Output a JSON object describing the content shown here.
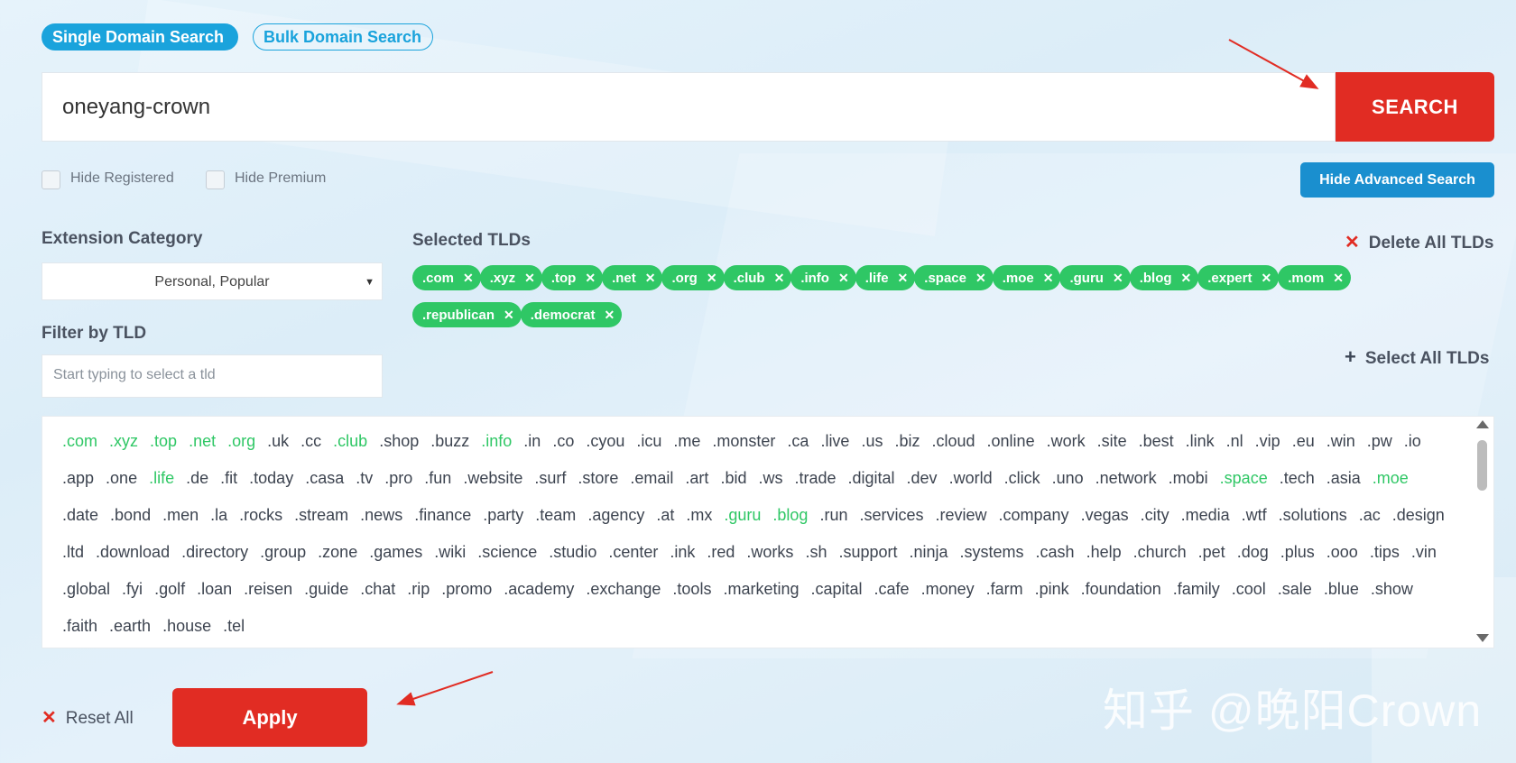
{
  "tabs": {
    "single": "Single Domain Search",
    "bulk": "Bulk Domain Search"
  },
  "search": {
    "value": "oneyang-crown",
    "button": "SEARCH"
  },
  "options": {
    "hide_registered": "Hide Registered",
    "hide_premium": "Hide Premium",
    "advanced_button": "Hide Advanced Search"
  },
  "extension_category": {
    "label": "Extension Category",
    "selected": "Personal, Popular"
  },
  "filter": {
    "label": "Filter by TLD",
    "placeholder": "Start typing to select a tld"
  },
  "selected_tlds": {
    "label": "Selected TLDs",
    "delete_all": "Delete All TLDs",
    "select_all": "Select All TLDs",
    "chips": [
      ".com",
      ".xyz",
      ".top",
      ".net",
      ".org",
      ".club",
      ".info",
      ".life",
      ".space",
      ".moe",
      ".guru",
      ".blog",
      ".expert",
      ".mom",
      ".republican",
      ".democrat"
    ]
  },
  "tld_list": [
    {
      "name": ".com",
      "selected": true
    },
    {
      "name": ".xyz",
      "selected": true
    },
    {
      "name": ".top",
      "selected": true
    },
    {
      "name": ".net",
      "selected": true
    },
    {
      "name": ".org",
      "selected": true
    },
    {
      "name": ".uk",
      "selected": false
    },
    {
      "name": ".cc",
      "selected": false
    },
    {
      "name": ".club",
      "selected": true
    },
    {
      "name": ".shop",
      "selected": false
    },
    {
      "name": ".buzz",
      "selected": false
    },
    {
      "name": ".info",
      "selected": true
    },
    {
      "name": ".in",
      "selected": false
    },
    {
      "name": ".co",
      "selected": false
    },
    {
      "name": ".cyou",
      "selected": false
    },
    {
      "name": ".icu",
      "selected": false
    },
    {
      "name": ".me",
      "selected": false
    },
    {
      "name": ".monster",
      "selected": false
    },
    {
      "name": ".ca",
      "selected": false
    },
    {
      "name": ".live",
      "selected": false
    },
    {
      "name": ".us",
      "selected": false
    },
    {
      "name": ".biz",
      "selected": false
    },
    {
      "name": ".cloud",
      "selected": false
    },
    {
      "name": ".online",
      "selected": false
    },
    {
      "name": ".work",
      "selected": false
    },
    {
      "name": ".site",
      "selected": false
    },
    {
      "name": ".best",
      "selected": false
    },
    {
      "name": ".link",
      "selected": false
    },
    {
      "name": ".nl",
      "selected": false
    },
    {
      "name": ".vip",
      "selected": false
    },
    {
      "name": ".eu",
      "selected": false
    },
    {
      "name": ".win",
      "selected": false
    },
    {
      "name": ".pw",
      "selected": false
    },
    {
      "name": ".io",
      "selected": false
    },
    {
      "name": ".app",
      "selected": false
    },
    {
      "name": ".one",
      "selected": false
    },
    {
      "name": ".life",
      "selected": true
    },
    {
      "name": ".de",
      "selected": false
    },
    {
      "name": ".fit",
      "selected": false
    },
    {
      "name": ".today",
      "selected": false
    },
    {
      "name": ".casa",
      "selected": false
    },
    {
      "name": ".tv",
      "selected": false
    },
    {
      "name": ".pro",
      "selected": false
    },
    {
      "name": ".fun",
      "selected": false
    },
    {
      "name": ".website",
      "selected": false
    },
    {
      "name": ".surf",
      "selected": false
    },
    {
      "name": ".store",
      "selected": false
    },
    {
      "name": ".email",
      "selected": false
    },
    {
      "name": ".art",
      "selected": false
    },
    {
      "name": ".bid",
      "selected": false
    },
    {
      "name": ".ws",
      "selected": false
    },
    {
      "name": ".trade",
      "selected": false
    },
    {
      "name": ".digital",
      "selected": false
    },
    {
      "name": ".dev",
      "selected": false
    },
    {
      "name": ".world",
      "selected": false
    },
    {
      "name": ".click",
      "selected": false
    },
    {
      "name": ".uno",
      "selected": false
    },
    {
      "name": ".network",
      "selected": false
    },
    {
      "name": ".mobi",
      "selected": false
    },
    {
      "name": ".space",
      "selected": true
    },
    {
      "name": ".tech",
      "selected": false
    },
    {
      "name": ".asia",
      "selected": false
    },
    {
      "name": ".moe",
      "selected": true
    },
    {
      "name": ".date",
      "selected": false
    },
    {
      "name": ".bond",
      "selected": false
    },
    {
      "name": ".men",
      "selected": false
    },
    {
      "name": ".la",
      "selected": false
    },
    {
      "name": ".rocks",
      "selected": false
    },
    {
      "name": ".stream",
      "selected": false
    },
    {
      "name": ".news",
      "selected": false
    },
    {
      "name": ".finance",
      "selected": false
    },
    {
      "name": ".party",
      "selected": false
    },
    {
      "name": ".team",
      "selected": false
    },
    {
      "name": ".agency",
      "selected": false
    },
    {
      "name": ".at",
      "selected": false
    },
    {
      "name": ".mx",
      "selected": false
    },
    {
      "name": ".guru",
      "selected": true
    },
    {
      "name": ".blog",
      "selected": true
    },
    {
      "name": ".run",
      "selected": false
    },
    {
      "name": ".services",
      "selected": false
    },
    {
      "name": ".review",
      "selected": false
    },
    {
      "name": ".company",
      "selected": false
    },
    {
      "name": ".vegas",
      "selected": false
    },
    {
      "name": ".city",
      "selected": false
    },
    {
      "name": ".media",
      "selected": false
    },
    {
      "name": ".wtf",
      "selected": false
    },
    {
      "name": ".solutions",
      "selected": false
    },
    {
      "name": ".ac",
      "selected": false
    },
    {
      "name": ".design",
      "selected": false
    },
    {
      "name": ".ltd",
      "selected": false
    },
    {
      "name": ".download",
      "selected": false
    },
    {
      "name": ".directory",
      "selected": false
    },
    {
      "name": ".group",
      "selected": false
    },
    {
      "name": ".zone",
      "selected": false
    },
    {
      "name": ".games",
      "selected": false
    },
    {
      "name": ".wiki",
      "selected": false
    },
    {
      "name": ".science",
      "selected": false
    },
    {
      "name": ".studio",
      "selected": false
    },
    {
      "name": ".center",
      "selected": false
    },
    {
      "name": ".ink",
      "selected": false
    },
    {
      "name": ".red",
      "selected": false
    },
    {
      "name": ".works",
      "selected": false
    },
    {
      "name": ".sh",
      "selected": false
    },
    {
      "name": ".support",
      "selected": false
    },
    {
      "name": ".ninja",
      "selected": false
    },
    {
      "name": ".systems",
      "selected": false
    },
    {
      "name": ".cash",
      "selected": false
    },
    {
      "name": ".help",
      "selected": false
    },
    {
      "name": ".church",
      "selected": false
    },
    {
      "name": ".pet",
      "selected": false
    },
    {
      "name": ".dog",
      "selected": false
    },
    {
      "name": ".plus",
      "selected": false
    },
    {
      "name": ".ooo",
      "selected": false
    },
    {
      "name": ".tips",
      "selected": false
    },
    {
      "name": ".vin",
      "selected": false
    },
    {
      "name": ".global",
      "selected": false
    },
    {
      "name": ".fyi",
      "selected": false
    },
    {
      "name": ".golf",
      "selected": false
    },
    {
      "name": ".loan",
      "selected": false
    },
    {
      "name": ".reisen",
      "selected": false
    },
    {
      "name": ".guide",
      "selected": false
    },
    {
      "name": ".chat",
      "selected": false
    },
    {
      "name": ".rip",
      "selected": false
    },
    {
      "name": ".promo",
      "selected": false
    },
    {
      "name": ".academy",
      "selected": false
    },
    {
      "name": ".exchange",
      "selected": false
    },
    {
      "name": ".tools",
      "selected": false
    },
    {
      "name": ".marketing",
      "selected": false
    },
    {
      "name": ".capital",
      "selected": false
    },
    {
      "name": ".cafe",
      "selected": false
    },
    {
      "name": ".money",
      "selected": false
    },
    {
      "name": ".farm",
      "selected": false
    },
    {
      "name": ".pink",
      "selected": false
    },
    {
      "name": ".foundation",
      "selected": false
    },
    {
      "name": ".family",
      "selected": false
    },
    {
      "name": ".cool",
      "selected": false
    },
    {
      "name": ".sale",
      "selected": false
    },
    {
      "name": ".blue",
      "selected": false
    },
    {
      "name": ".show",
      "selected": false
    },
    {
      "name": ".faith",
      "selected": false
    },
    {
      "name": ".earth",
      "selected": false
    },
    {
      "name": ".house",
      "selected": false
    },
    {
      "name": ".tel",
      "selected": false
    }
  ],
  "actions": {
    "reset": "Reset All",
    "apply": "Apply"
  },
  "watermark": "知乎 @晚阳Crown",
  "icons": {
    "delete": "close-icon",
    "select_all": "plus-icon",
    "chip_remove": "close-icon",
    "dropdown": "caret-down-icon"
  },
  "colors": {
    "primary_blue": "#1aa3dc",
    "accent_red": "#e12c23",
    "selected_green": "#2fc765"
  }
}
